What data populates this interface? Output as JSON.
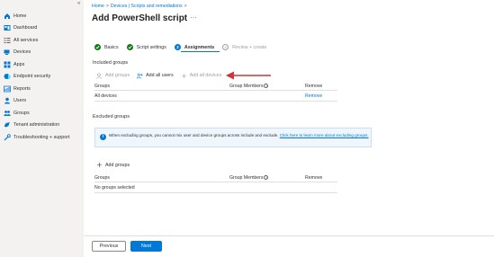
{
  "sidebar": {
    "collapse_glyph": "«",
    "items": [
      {
        "label": "Home",
        "icon": "home-icon",
        "color": "#0078d4"
      },
      {
        "label": "Dashboard",
        "icon": "dashboard-icon",
        "color": "#0078d4"
      },
      {
        "label": "All services",
        "icon": "all-services-icon",
        "color": "#605e5c"
      },
      {
        "label": "Devices",
        "icon": "devices-icon",
        "color": "#0078d4"
      },
      {
        "label": "Apps",
        "icon": "apps-icon",
        "color": "#0078d4"
      },
      {
        "label": "Endpoint security",
        "icon": "endpoint-security-icon",
        "color": "#0078d4"
      },
      {
        "label": "Reports",
        "icon": "reports-icon",
        "color": "#0078d4"
      },
      {
        "label": "Users",
        "icon": "users-icon",
        "color": "#0078d4"
      },
      {
        "label": "Groups",
        "icon": "groups-icon",
        "color": "#0078d4"
      },
      {
        "label": "Tenant administration",
        "icon": "tenant-admin-icon",
        "color": "#0078d4"
      },
      {
        "label": "Troubleshooting + support",
        "icon": "troubleshooting-icon",
        "color": "#0078d4"
      }
    ]
  },
  "breadcrumb": {
    "items": [
      "Home",
      "Devices | Scripts and remediations"
    ],
    "separator": ">"
  },
  "page": {
    "title": "Add PowerShell script",
    "more": "···"
  },
  "steps": [
    {
      "label": "Basics",
      "state": "done"
    },
    {
      "label": "Script settings",
      "state": "done"
    },
    {
      "label": "Assignments",
      "state": "current",
      "number": "3"
    },
    {
      "label": "Review + create",
      "state": "future",
      "number": "4"
    }
  ],
  "included": {
    "heading": "Included groups",
    "actions": {
      "add_groups": "Add groups",
      "add_all_users": "Add all users",
      "add_all_devices": "Add all devices"
    },
    "columns": {
      "groups": "Groups",
      "members": "Group Members",
      "remove": "Remove"
    },
    "rows": [
      {
        "group": "All devices",
        "members": "",
        "remove": "Remove"
      }
    ]
  },
  "excluded": {
    "heading": "Excluded groups",
    "info_text": "When excluding groups, you cannot mix user and device groups across include and exclude.",
    "info_link": "Click here to learn more about excluding groups.",
    "add_groups": "Add groups",
    "columns": {
      "groups": "Groups",
      "members": "Group Members",
      "remove": "Remove"
    },
    "empty_text": "No groups selected"
  },
  "footer": {
    "previous": "Previous",
    "next": "Next"
  },
  "colors": {
    "accent": "#0078d4",
    "success": "#107c10",
    "annotation_arrow": "#d13438"
  }
}
